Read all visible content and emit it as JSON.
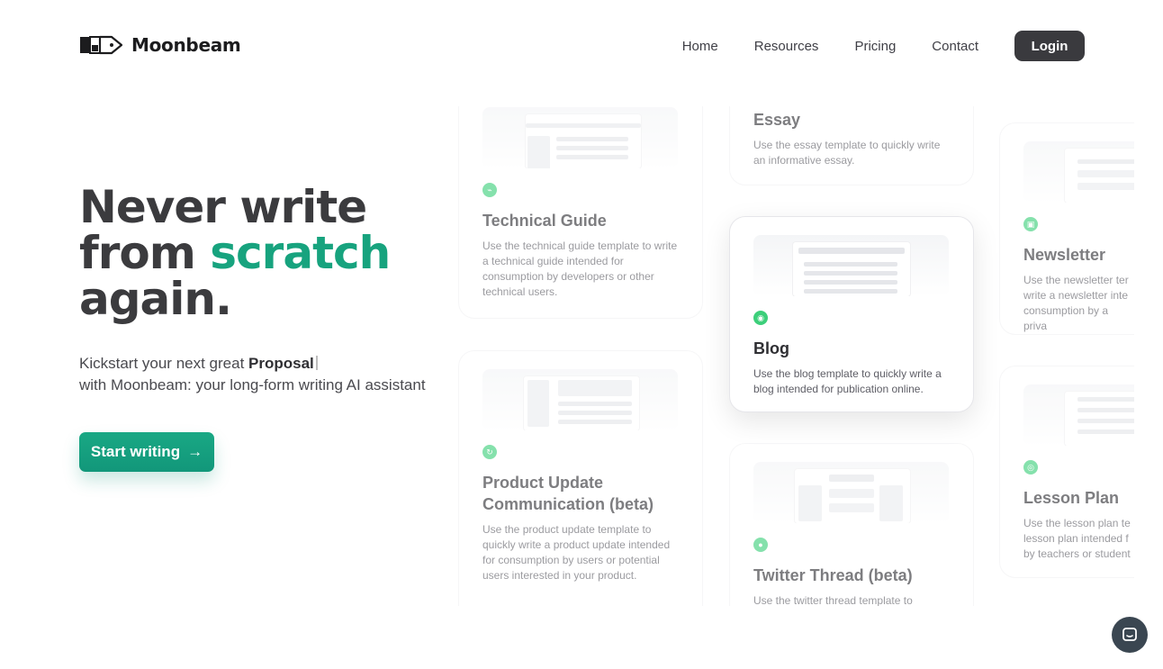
{
  "brand": {
    "name": "Moonbeam",
    "logo_icon": "pen-nib-logo-icon"
  },
  "nav": {
    "links": [
      "Home",
      "Resources",
      "Pricing",
      "Contact"
    ],
    "login_label": "Login"
  },
  "hero": {
    "title_line1": "Never write",
    "title_line2_prefix": "from ",
    "title_line2_accent": "scratch",
    "title_line3": "again.",
    "sub_prefix": "Kickstart your next great ",
    "sub_bold": "Proposal",
    "sub_line2": "with Moonbeam: your long-form writing AI assistant",
    "cta_label": "Start writing",
    "cta_arrow": "→",
    "accent_color": "#17a37e"
  },
  "templates": [
    {
      "title": "Technical Guide",
      "desc": "Use the technical guide template to write a technical guide intended for consumption by developers or other technical users.",
      "icon": "link-icon"
    },
    {
      "title": "Product Update Communication (beta)",
      "desc": "Use the product update template to quickly write a product update intended for consumption by users or potential users interested in your product.",
      "icon": "refresh-icon"
    },
    {
      "title": "Essay",
      "desc": "Use the essay template to quickly write an informative essay.",
      "icon": "essay-icon"
    },
    {
      "title": "Blog",
      "desc": "Use the blog template to quickly write a blog intended for publication online.",
      "icon": "rss-icon"
    },
    {
      "title": "Twitter Thread (beta)",
      "desc": "Use the twitter thread template to",
      "icon": "chat-icon"
    },
    {
      "title": "Newsletter",
      "desc": "Use the newsletter ter write a newsletter inte consumption by a priva",
      "icon": "mail-icon"
    },
    {
      "title": "Lesson Plan",
      "desc": "Use the lesson plan te lesson plan intended f by teachers or student",
      "icon": "book-icon"
    }
  ],
  "chat": {
    "icon": "chat-bubble-icon"
  }
}
